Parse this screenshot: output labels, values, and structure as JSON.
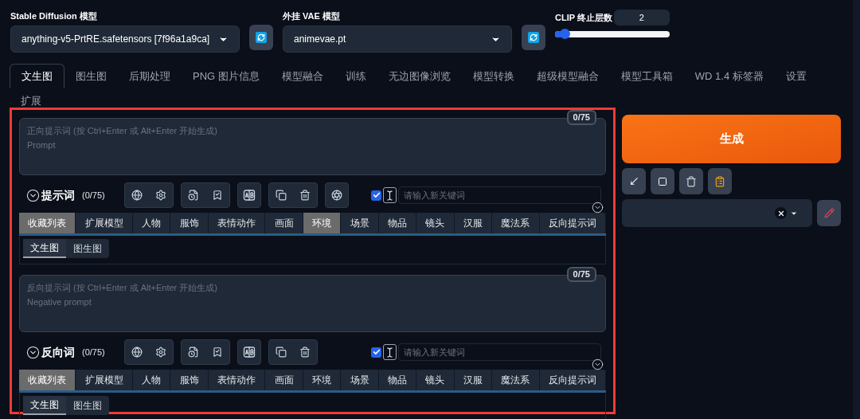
{
  "model_selectors": [
    {
      "label": "Stable Diffusion 模型",
      "value": "anything-v5-PrtRE.safetensors [7f96a1a9ca]"
    },
    {
      "label": "外挂 VAE 模型",
      "value": "animevae.pt"
    }
  ],
  "clip_skip": {
    "label": "CLIP 终止层数",
    "value": "2",
    "level": 0.08
  },
  "tabs": [
    {
      "label": "文生图",
      "selected": true
    },
    {
      "label": "图生图",
      "selected": false
    },
    {
      "label": "后期处理",
      "selected": false
    },
    {
      "label": "PNG 图片信息",
      "selected": false
    },
    {
      "label": "模型融合",
      "selected": false
    },
    {
      "label": "训练",
      "selected": false
    },
    {
      "label": "无边图像浏览",
      "selected": false
    },
    {
      "label": "模型转换",
      "selected": false
    },
    {
      "label": "超级模型融合",
      "selected": false
    },
    {
      "label": "模型工具箱",
      "selected": false
    },
    {
      "label": "WD 1.4 标签器",
      "selected": false
    },
    {
      "label": "设置",
      "selected": false
    },
    {
      "label": "扩展",
      "selected": false
    }
  ],
  "prompts": [
    {
      "placeholder": "正向提示词 (按 Ctrl+Enter 或 Alt+Enter 开始生成)\nPrompt",
      "token_counter": "0/75",
      "title": "提示词",
      "count": "(0/75)",
      "ai_button": true,
      "keyword_checked": true,
      "keyword_placeholder": "请输入新关键词",
      "categories": [
        {
          "label": "收藏列表",
          "selected": true
        },
        {
          "label": "扩展模型",
          "selected": false
        },
        {
          "label": "人物",
          "selected": false
        },
        {
          "label": "服饰",
          "selected": false
        },
        {
          "label": "表情动作",
          "selected": false
        },
        {
          "label": "画面",
          "selected": false
        },
        {
          "label": "环境",
          "selected": true
        },
        {
          "label": "场景",
          "selected": false
        },
        {
          "label": "物品",
          "selected": false
        },
        {
          "label": "镜头",
          "selected": false
        },
        {
          "label": "汉服",
          "selected": false
        },
        {
          "label": "魔法系",
          "selected": false
        },
        {
          "label": "反向提示词",
          "selected": false
        }
      ],
      "subtabs": [
        {
          "label": "文生图",
          "selected": true
        },
        {
          "label": "图生图",
          "selected": false
        }
      ]
    },
    {
      "placeholder": "反向提示词 (按 Ctrl+Enter 或 Alt+Enter 开始生成)\nNegative prompt",
      "token_counter": "0/75",
      "title": "反向词",
      "count": "(0/75)",
      "ai_button": false,
      "keyword_checked": true,
      "keyword_placeholder": "请输入新关键词",
      "categories": [
        {
          "label": "收藏列表",
          "selected": true
        },
        {
          "label": "扩展模型",
          "selected": false
        },
        {
          "label": "人物",
          "selected": false
        },
        {
          "label": "服饰",
          "selected": false
        },
        {
          "label": "表情动作",
          "selected": false
        },
        {
          "label": "画面",
          "selected": false
        },
        {
          "label": "环境",
          "selected": false
        },
        {
          "label": "场景",
          "selected": false
        },
        {
          "label": "物品",
          "selected": false
        },
        {
          "label": "镜头",
          "selected": false
        },
        {
          "label": "汉服",
          "selected": false
        },
        {
          "label": "魔法系",
          "selected": false
        },
        {
          "label": "反向提示词",
          "selected": false
        }
      ],
      "subtabs": [
        {
          "label": "文生图",
          "selected": true
        },
        {
          "label": "图生图",
          "selected": false
        }
      ]
    }
  ],
  "generate_button": "生成"
}
